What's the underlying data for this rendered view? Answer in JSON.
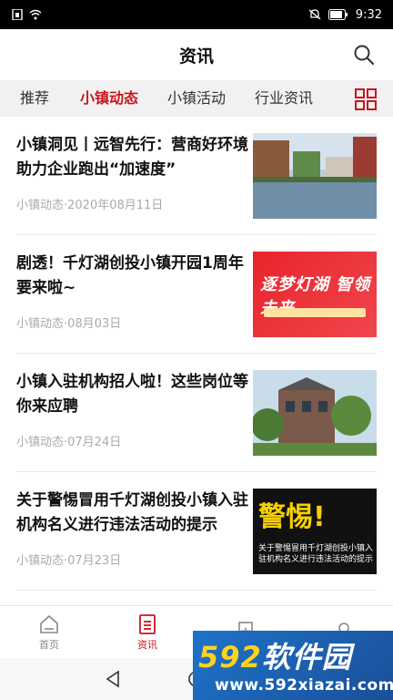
{
  "status_bar": {
    "time": "9:32"
  },
  "header": {
    "title": "资讯"
  },
  "tabs": [
    {
      "label": "推荐"
    },
    {
      "label": "小镇动态"
    },
    {
      "label": "小镇活动"
    },
    {
      "label": "行业资讯"
    }
  ],
  "active_tab": "小镇动态",
  "news": [
    {
      "title": "小镇洞见丨远智先行：营商好环境助力企业跑出“加速度”",
      "meta": "小镇动态·2020年08月11日"
    },
    {
      "title": "剧透！千灯湖创投小镇开园1周年要来啦~",
      "meta": "小镇动态·08月03日",
      "thumb_text": "逐梦灯湖 智领未来"
    },
    {
      "title": "小镇入驻机构招人啦！这些岗位等你来应聘",
      "meta": "小镇动态·07月24日"
    },
    {
      "title": "关于警惕冒用千灯湖创投小镇入驻机构名义进行违法活动的提示",
      "meta": "小镇动态·07月23日",
      "thumb_title": "警惕!",
      "thumb_caption": "关于警惕冒用千灯湖创投小镇入驻机构名义进行违法活动的提示"
    }
  ],
  "bottom_nav": [
    {
      "label": "首页",
      "icon": "home-icon"
    },
    {
      "label": "资讯",
      "icon": "document-icon"
    },
    {
      "label": "",
      "icon": "bookmark-icon"
    },
    {
      "label": "",
      "icon": "user-icon"
    }
  ],
  "watermark": {
    "brand_num": "592",
    "brand_text": "软件园",
    "url": "www.592xiazai.com"
  },
  "colors": {
    "accent": "#c8161d"
  }
}
